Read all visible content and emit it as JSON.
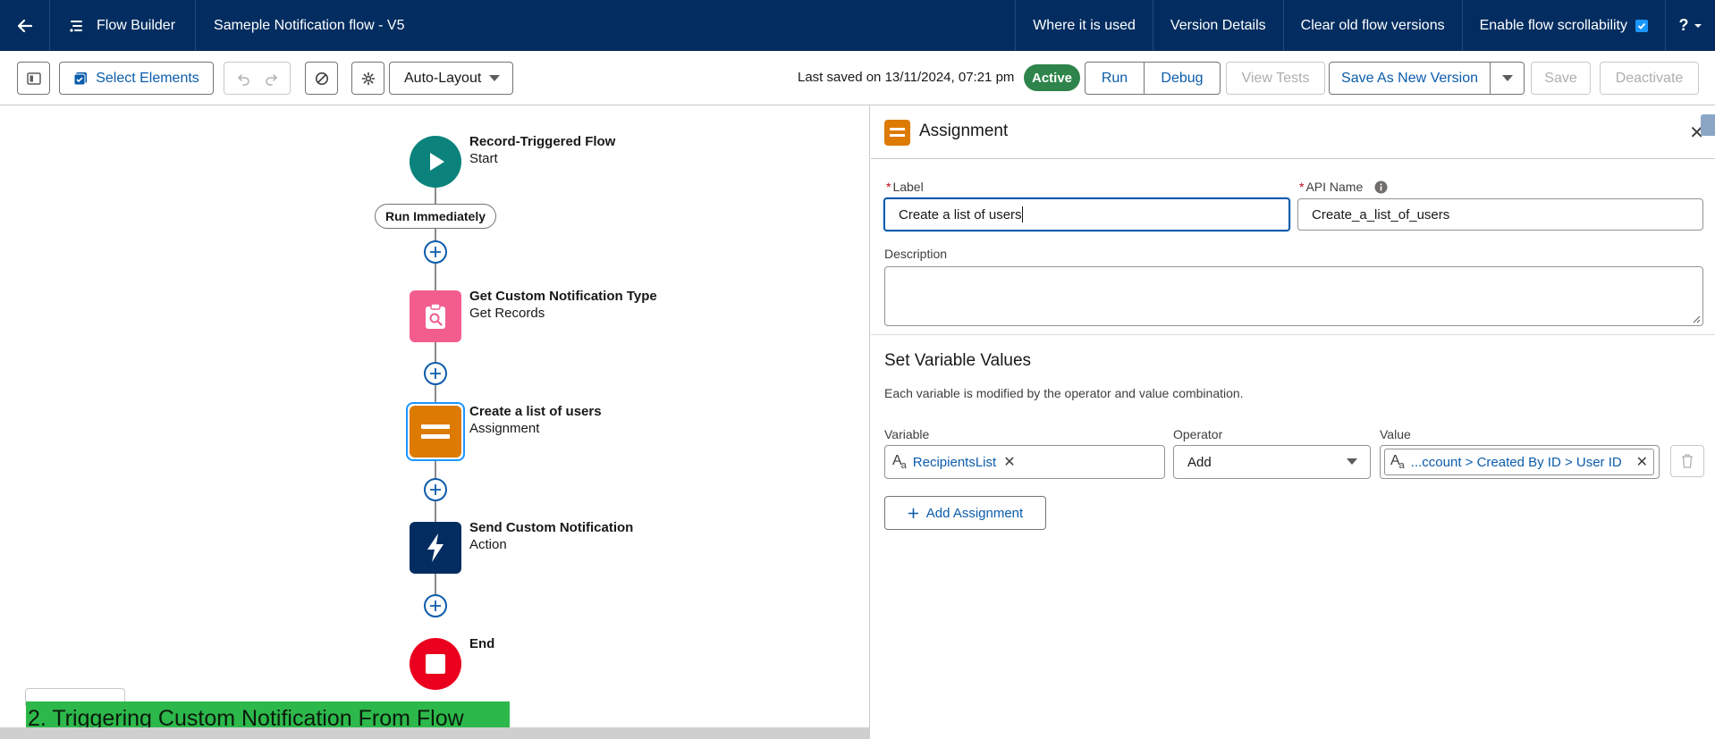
{
  "header": {
    "app_name": "Flow Builder",
    "flow_name": "Sameple Notification flow - V5",
    "nav": [
      "Where it is used",
      "Version Details",
      "Clear old flow versions",
      "Enable flow scrollability"
    ],
    "help": "?"
  },
  "toolbar": {
    "select_elements": "Select Elements",
    "layout": "Auto-Layout",
    "last_saved": "Last saved on 13/11/2024, 07:21 pm",
    "status": "Active",
    "run": "Run",
    "debug": "Debug",
    "view_tests": "View Tests",
    "save_as_new_version": "Save As New Version",
    "save": "Save",
    "deactivate": "Deactivate"
  },
  "canvas": {
    "start": {
      "title": "Record-Triggered Flow",
      "subtitle": "Start"
    },
    "run_immediately": "Run Immediately",
    "get_records": {
      "title": "Get Custom Notification Type",
      "subtitle": "Get Records"
    },
    "assignment": {
      "title": "Create a list of users",
      "subtitle": "Assignment"
    },
    "action": {
      "title": "Send Custom Notification",
      "subtitle": "Action"
    },
    "end": {
      "title": "End"
    },
    "banner": "2. Triggering Custom Notification From Flow"
  },
  "panel": {
    "title": "Assignment",
    "label_field": {
      "label": "Label",
      "value": "Create a list of users"
    },
    "api_name_field": {
      "label": "API Name",
      "value": "Create_a_list_of_users"
    },
    "description_field": {
      "label": "Description",
      "value": ""
    },
    "section_title": "Set Variable Values",
    "section_desc": "Each variable is modified by the operator and value combination.",
    "variable_label": "Variable",
    "operator_label": "Operator",
    "value_label": "Value",
    "row": {
      "variable": "RecipientsList",
      "operator": "Add",
      "value": "...ccount > Created By ID > User ID"
    },
    "add_assignment": "Add Assignment"
  },
  "colors": {
    "header_bg": "#032d60",
    "start_node": "#0b827c",
    "get_records_node": "#f35d8e",
    "assignment_node": "#dd7a01",
    "action_node": "#032d60",
    "end_node": "#ea001e",
    "active_badge": "#2e844a",
    "banner": "#2db84b"
  }
}
